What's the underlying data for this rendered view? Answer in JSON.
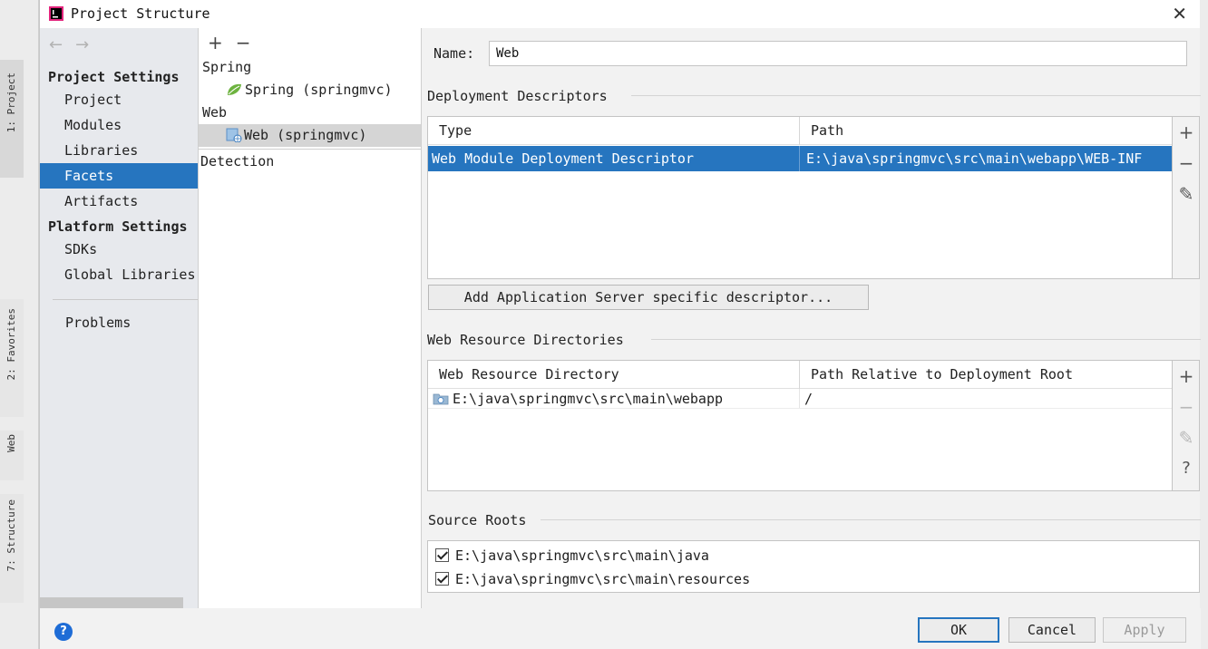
{
  "window": {
    "title": "Project Structure",
    "close_glyph": "✕"
  },
  "ide": {
    "tool_windows": [
      "1: Project",
      "2: Favorites",
      "Web",
      "7: Structure"
    ]
  },
  "nav": {
    "back_glyph": "←",
    "forward_glyph": "→",
    "project_settings": "Project Settings",
    "items_project": [
      "Project",
      "Modules",
      "Libraries",
      "Facets",
      "Artifacts"
    ],
    "platform_settings": "Platform Settings",
    "items_platform": [
      "SDKs",
      "Global Libraries"
    ],
    "problems": "Problems",
    "selected": "Facets"
  },
  "tree": {
    "add_glyph": "+",
    "remove_glyph": "−",
    "group_spring": "Spring",
    "item_spring": "Spring (springmvc)",
    "group_web": "Web",
    "item_web": "Web (springmvc)",
    "detection": "Detection"
  },
  "form": {
    "name_label": "Name:",
    "name_value": "Web",
    "deployment_title": "Deployment Descriptors",
    "deploy_col_type": "Type",
    "deploy_col_path": "Path",
    "deploy_rows": [
      {
        "type": "Web Module Deployment Descriptor",
        "path": "E:\\java\\springmvc\\src\\main\\webapp\\WEB-INF"
      }
    ],
    "add_descriptor_button": "Add Application Server specific descriptor...",
    "webres_title": "Web Resource Directories",
    "webres_col_dir": "Web Resource Directory",
    "webres_col_rel": "Path Relative to Deployment Root",
    "webres_rows": [
      {
        "dir": "E:\\java\\springmvc\\src\\main\\webapp",
        "rel": "/"
      }
    ],
    "source_roots_title": "Source Roots",
    "source_roots": [
      {
        "path": "E:\\java\\springmvc\\src\\main\\java",
        "checked": true
      },
      {
        "path": "E:\\java\\springmvc\\src\\main\\resources",
        "checked": true
      }
    ]
  },
  "side_tools": {
    "add": "+",
    "remove": "−",
    "edit": "✎",
    "help": "?"
  },
  "footer": {
    "help": "?",
    "ok": "OK",
    "cancel": "Cancel",
    "apply": "Apply"
  },
  "colors": {
    "selection": "#2675bf",
    "accent_help": "#1e6cd6"
  }
}
